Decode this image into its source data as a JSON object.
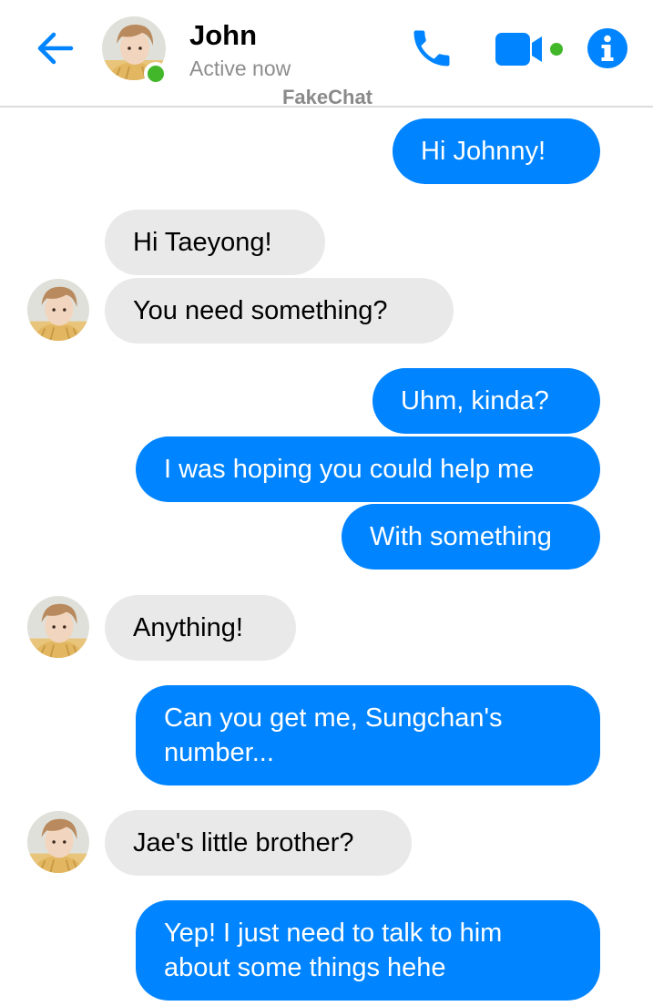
{
  "header": {
    "contact_name": "John",
    "status": "Active now",
    "watermark": "FakeChat",
    "icons": [
      "back-arrow-icon",
      "phone-icon",
      "video-camera-icon",
      "info-icon"
    ],
    "accent_color": "#0084ff",
    "online_color": "#42b72a"
  },
  "messages": [
    {
      "direction": "outgoing",
      "text": "Hi Johnny!"
    },
    {
      "direction": "incoming",
      "text": "Hi Taeyong!"
    },
    {
      "direction": "incoming",
      "text": "You need something?"
    },
    {
      "direction": "outgoing",
      "text": "Uhm, kinda?"
    },
    {
      "direction": "outgoing",
      "text": "I was hoping you could help me"
    },
    {
      "direction": "outgoing",
      "text": "With something"
    },
    {
      "direction": "incoming",
      "text": "Anything!"
    },
    {
      "direction": "outgoing",
      "text": "Can you get me,  Sungchan's number..."
    },
    {
      "direction": "incoming",
      "text": "Jae's little brother?"
    },
    {
      "direction": "outgoing",
      "text": "Yep!  I just need to talk to him about some things hehe"
    }
  ],
  "colors": {
    "outgoing_bubble": "#0084ff",
    "incoming_bubble": "#e9e9e9"
  }
}
